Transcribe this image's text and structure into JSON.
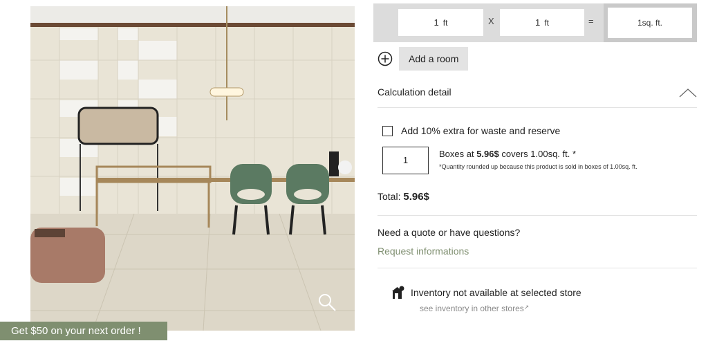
{
  "promo": {
    "label": "Get $50 on your next order !"
  },
  "calculator": {
    "length": {
      "value": "1",
      "unit": "ft"
    },
    "operator_times": "X",
    "width": {
      "value": "1",
      "unit": "ft"
    },
    "operator_equals": "=",
    "result": "1sq. ft."
  },
  "add_room": {
    "label": "Add a room"
  },
  "calculation_detail": {
    "label": "Calculation detail"
  },
  "waste": {
    "label": "Add 10% extra for waste and reserve",
    "checked": false
  },
  "boxes": {
    "quantity": "1",
    "prefix": "Boxes at ",
    "price": "5.96$",
    "suffix": " covers 1.00sq. ft. *",
    "note": "*Quantity rounded up because this product is sold in boxes of 1.00sq. ft."
  },
  "total": {
    "label": "Total: ",
    "value": "5.96$"
  },
  "quote": {
    "question": "Need a quote or have questions?",
    "link": "Request informations"
  },
  "inventory": {
    "status": "Inventory not available at selected store",
    "link": "see inventory in other stores"
  },
  "icons": [
    "search-icon",
    "plus-circle-icon",
    "chevron-up-icon",
    "store-icon",
    "external-link-icon"
  ],
  "colors": {
    "accent_green": "#7f8f70",
    "calc_bg": "#dcdcdc",
    "button_bg": "#e3e3e3"
  }
}
